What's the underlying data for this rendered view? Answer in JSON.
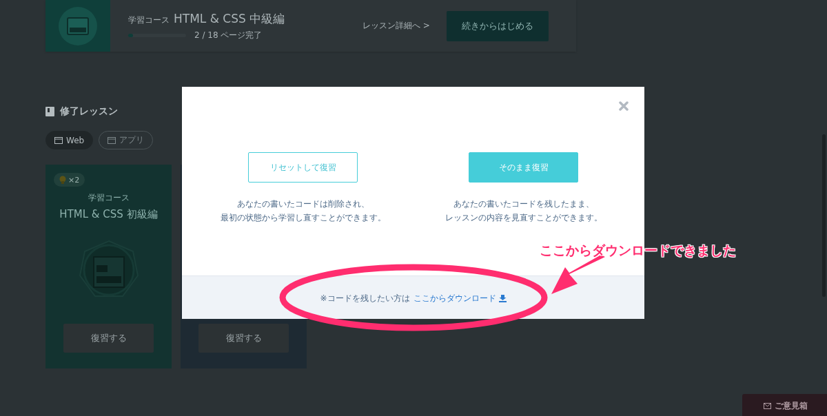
{
  "current_course": {
    "course_label": "学習コース",
    "title": "HTML & CSS 中級編",
    "progress": {
      "level": 0.08
    },
    "progress_text": "2 / 18 ページ完了",
    "details_link": "レッスン詳細へ >",
    "continue_button": "続きからはじめる"
  },
  "completed_section": {
    "heading": "修了レッスン",
    "tabs": [
      {
        "label": "Web",
        "selected": true
      },
      {
        "label": "アプリ",
        "selected": false
      }
    ],
    "cards": [
      {
        "badge": "×2",
        "course_label": "学習コース",
        "title": "HTML & CSS 初級編",
        "button": "復習する",
        "color": "#133330"
      },
      {
        "button": "復習する",
        "color": "#1e2a33"
      }
    ]
  },
  "modal": {
    "options": [
      {
        "kind": "outline",
        "button": "リセットして復習",
        "description": [
          "あなたの書いたコードは削除され、",
          "最初の状態から学習し直すことができます。"
        ]
      },
      {
        "kind": "filled",
        "button": "そのまま復習",
        "description": [
          "あなたの書いたコードを残したまま、",
          "レッスンの内容を見直すことができます。"
        ]
      }
    ],
    "footer_text": "※コードを残したい方は",
    "download_link": "ここからダウンロード"
  },
  "annotation": {
    "text": "ここからダウンロードできました"
  },
  "feedback_button": "ご意見箱"
}
